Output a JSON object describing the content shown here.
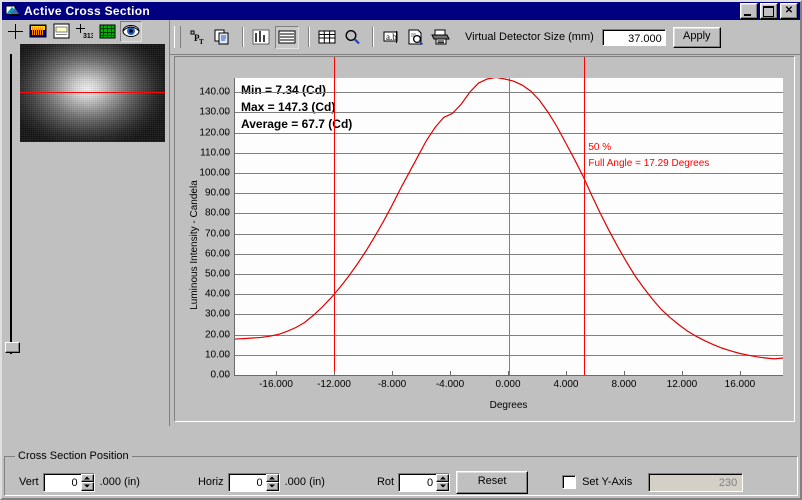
{
  "window": {
    "title": "Active Cross Section",
    "icon": "app-icon",
    "buttons": {
      "minimize": "minimize-button",
      "maximize": "maximize-button",
      "close": "close-button"
    }
  },
  "left_toolbar": {
    "items": [
      {
        "name": "crosshair-icon",
        "pressed": false
      },
      {
        "name": "color-bar-icon",
        "pressed": false
      },
      {
        "name": "window-icon",
        "pressed": false
      },
      {
        "name": "crosshair-digits-icon",
        "pressed": false
      },
      {
        "name": "grid-icon",
        "pressed": false
      },
      {
        "name": "eye-icon",
        "pressed": true
      }
    ]
  },
  "right_toolbar": {
    "items": [
      {
        "name": "point-temp-icon"
      },
      {
        "name": "copy-icon"
      },
      {
        "name": "bar-graph-icon"
      },
      {
        "name": "line-list-icon",
        "pressed": true
      },
      {
        "name": "table-icon"
      },
      {
        "name": "zoom-icon"
      },
      {
        "name": "text-label-icon"
      },
      {
        "name": "preview-icon"
      },
      {
        "name": "print-icon"
      }
    ],
    "detector_label": "Virtual Detector Size (mm)",
    "detector_value": "37.000",
    "apply_label": "Apply"
  },
  "chart_data": {
    "type": "line",
    "title": "",
    "xlabel": "Degrees",
    "ylabel": "Luminous Intensity - Candela",
    "xlim": [
      -18.9,
      18.9
    ],
    "ylim": [
      0,
      147
    ],
    "grid": true,
    "line_color": "#e00000",
    "xticks": [
      "-16.000",
      "-12.000",
      "-8.000",
      "-4.000",
      "0.000",
      "4.000",
      "8.000",
      "12.000",
      "16.000"
    ],
    "xtick_values": [
      -16,
      -12,
      -8,
      -4,
      0,
      4,
      8,
      12,
      16
    ],
    "yticks": [
      "0.00",
      "10.00",
      "20.00",
      "30.00",
      "40.00",
      "50.00",
      "60.00",
      "70.00",
      "80.00",
      "90.00",
      "100.00",
      "110.00",
      "120.00",
      "130.00",
      "140.00"
    ],
    "ytick_values": [
      0,
      10,
      20,
      30,
      40,
      50,
      60,
      70,
      80,
      90,
      100,
      110,
      120,
      130,
      140
    ],
    "stats": {
      "min": "Min = 7.34 (Cd)",
      "max": "Max = 147.3 (Cd)",
      "average": "Average = 67.7 (Cd)"
    },
    "annotations": [
      {
        "name": "half-angle-percent",
        "text": "50 %",
        "color": "#ff0000"
      },
      {
        "name": "full-angle-value",
        "text": "Full Angle = 17.29 Degrees",
        "color": "#ff0000"
      }
    ],
    "markers": [
      {
        "name": "left-half-max-line",
        "x": -12.09,
        "color": "#ff0000"
      },
      {
        "name": "right-half-max-line",
        "x": 5.2,
        "color": "#ff0000"
      }
    ],
    "x": [
      -18.9,
      -18.3,
      -17.7,
      -17.1,
      -16.5,
      -15.9,
      -15.3,
      -14.7,
      -14.1,
      -13.5,
      -12.9,
      -12.3,
      -11.7,
      -11.1,
      -10.5,
      -9.9,
      -9.3,
      -8.7,
      -8.1,
      -7.5,
      -6.9,
      -6.3,
      -5.7,
      -5.1,
      -4.5,
      -3.9,
      -3.3,
      -2.7,
      -2.1,
      -1.5,
      -0.9,
      -0.3,
      0.3,
      0.9,
      1.5,
      2.1,
      2.7,
      3.3,
      3.9,
      4.5,
      5.1,
      5.7,
      6.3,
      6.9,
      7.5,
      8.1,
      8.7,
      9.3,
      9.9,
      10.5,
      11.1,
      11.7,
      12.3,
      12.9,
      13.5,
      14.1,
      14.7,
      15.3,
      15.9,
      16.5,
      17.1,
      17.7,
      18.3,
      18.9
    ],
    "y": [
      17.8,
      18.0,
      18.3,
      18.6,
      19.2,
      20.1,
      21.6,
      23.5,
      26.0,
      29.5,
      33.5,
      38.0,
      43.0,
      48.5,
      54.5,
      61.0,
      68.0,
      75.5,
      83.5,
      92.0,
      100.0,
      108.0,
      116.0,
      122.5,
      127.5,
      129.5,
      134.0,
      140.0,
      144.5,
      146.5,
      147.3,
      146.5,
      145.5,
      143.5,
      140.5,
      136.0,
      130.0,
      123.0,
      115.0,
      107.0,
      98.5,
      89.0,
      80.0,
      71.5,
      63.5,
      56.0,
      49.0,
      43.0,
      37.5,
      32.5,
      28.5,
      25.0,
      21.8,
      19.2,
      17.0,
      15.0,
      13.3,
      11.9,
      10.7,
      9.8,
      9.0,
      8.4,
      8.0,
      8.4
    ]
  },
  "bottom_panel": {
    "group_label": "Cross Section Position",
    "vert": {
      "label": "Vert",
      "value": "0",
      "unit": ".000 (in)"
    },
    "horiz": {
      "label": "Horiz",
      "value": "0",
      "unit": ".000 (in)"
    },
    "rot": {
      "label": "Rot",
      "value": "0"
    },
    "reset_label": "Reset",
    "set_y_axis": {
      "label": "Set Y-Axis",
      "checked": false,
      "value": "230"
    }
  }
}
